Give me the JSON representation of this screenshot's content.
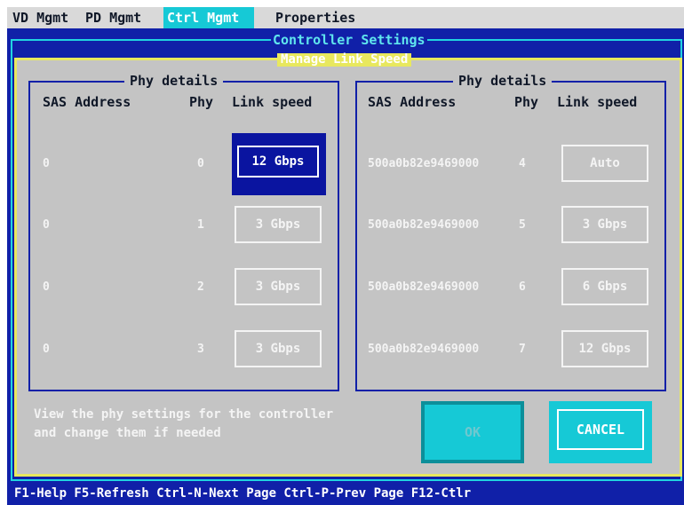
{
  "menubar": {
    "tabs": [
      {
        "label": "VD Mgmt"
      },
      {
        "label": "PD Mgmt"
      },
      {
        "label": "Ctrl Mgmt"
      },
      {
        "label": "Properties"
      }
    ]
  },
  "window_title": "Controller Settings",
  "dialog_title": "Manage Link Speed",
  "left_group": {
    "title": "Phy details",
    "headers": {
      "sas": "SAS Address",
      "phy": "Phy",
      "speed": "Link speed"
    },
    "rows": [
      {
        "sas": "0",
        "phy": "0",
        "speed": "12 Gbps"
      },
      {
        "sas": "0",
        "phy": "1",
        "speed": "3 Gbps"
      },
      {
        "sas": "0",
        "phy": "2",
        "speed": "3 Gbps"
      },
      {
        "sas": "0",
        "phy": "3",
        "speed": "3 Gbps"
      }
    ]
  },
  "right_group": {
    "title": "Phy details",
    "headers": {
      "sas": "SAS Address",
      "phy": "Phy",
      "speed": "Link speed"
    },
    "rows": [
      {
        "sas": "500a0b82e9469000",
        "phy": "4",
        "speed": "Auto"
      },
      {
        "sas": "500a0b82e9469000",
        "phy": "5",
        "speed": "3 Gbps"
      },
      {
        "sas": "500a0b82e9469000",
        "phy": "6",
        "speed": "6 Gbps"
      },
      {
        "sas": "500a0b82e9469000",
        "phy": "7",
        "speed": "12 Gbps"
      }
    ]
  },
  "help_text": {
    "line1": "View the phy settings for the controller",
    "line2": "and change them if needed"
  },
  "buttons": {
    "ok": "OK",
    "cancel": "CANCEL"
  },
  "footer": "F1-Help F5-Refresh Ctrl-N-Next Page Ctrl-P-Prev Page F12-Ctlr",
  "colors": {
    "screen_blue": "#1020a8",
    "dialog_gray": "#c4c4c4",
    "accent_cyan": "#16c9d6",
    "dialog_border_yellow": "#e8e85e"
  }
}
